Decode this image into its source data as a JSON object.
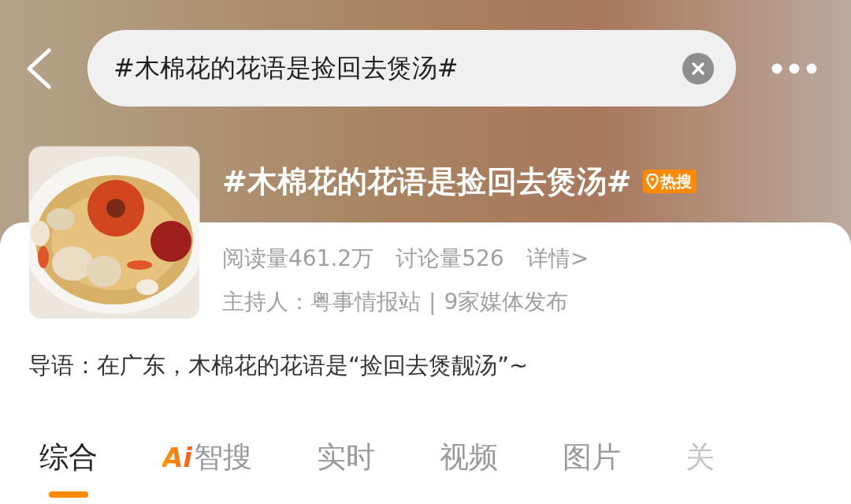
{
  "top_bar": {
    "search": {
      "value": "#木棉花的花语是捡回去煲汤#"
    }
  },
  "topic": {
    "title": "#木棉花的花语是捡回去煲汤#",
    "badge": "热搜",
    "stats": [
      "阅读量461.2万",
      "讨论量526"
    ],
    "details_link": "详情>",
    "host": "主持人：粤事情报站",
    "separator": "|",
    "media": "9家媒体发布"
  },
  "intro": "导语：在广东，木棉花的花语是“捡回去煲靓汤”~",
  "tabs": [
    {
      "kind": "text",
      "label": "综合",
      "selected": true
    },
    {
      "kind": "ai",
      "logo": "Ai",
      "label": "智搜",
      "selected": false
    },
    {
      "kind": "text",
      "label": "实时",
      "selected": false
    },
    {
      "kind": "text",
      "label": "视频",
      "selected": false
    },
    {
      "kind": "text",
      "label": "图片",
      "selected": false
    },
    {
      "kind": "faded",
      "label": "关",
      "selected": false
    }
  ]
}
